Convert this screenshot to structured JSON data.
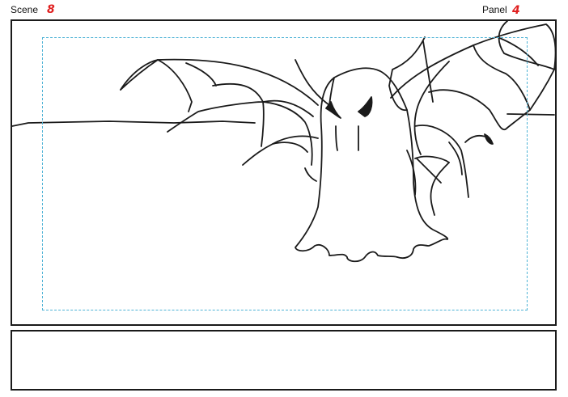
{
  "header": {
    "scene_label": "Scene",
    "scene_number": "8",
    "panel_label": "Panel",
    "panel_number": "4"
  },
  "colors": {
    "number_ink": "#e02020",
    "frame": "#1a1a1a",
    "safe_area_guide": "#4fb3d6",
    "sketch_ink": "#1a1a1a"
  },
  "sketch": {
    "subject": "ghost-with-bat-wings-and-web"
  },
  "caption": {
    "text": ""
  }
}
